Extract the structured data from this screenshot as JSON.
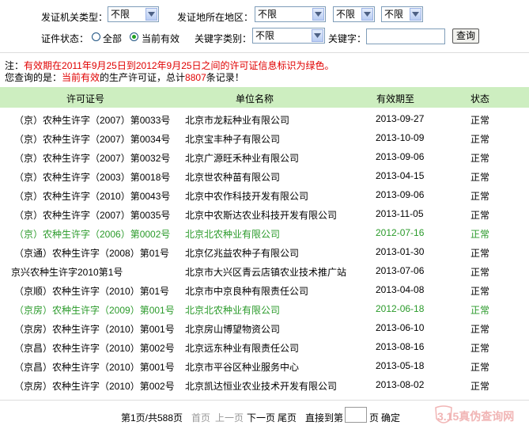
{
  "filters": {
    "issuer_type_label": "发证机关类型：",
    "issuer_type_value": "不限",
    "region_label": "发证地所在地区：",
    "region_values": [
      "不限",
      "不限",
      "不限"
    ],
    "status_label": "证件状态：",
    "radio_all_label": "全部",
    "radio_current_label": "当前有效",
    "keyword_type_label": "关键字类别：",
    "keyword_type_value": "不限",
    "keyword_label": "关键字：",
    "keyword_value": "",
    "search_button": "查询"
  },
  "notice": {
    "prefix": "注：",
    "text": "有效期在2011年9月25日到2012年9月25日之间的许可证信息标识为绿色。",
    "query_prefix": "您查询的是：",
    "query_status": "当前有效",
    "query_mid": "的生产许可证，总计",
    "query_count": "8807",
    "query_suffix": "条记录！"
  },
  "table": {
    "columns": [
      "许可证号",
      "单位名称",
      "有效期至",
      "状态"
    ],
    "rows": [
      {
        "license": "（京）农种生许字（2007）第0033号",
        "company": "北京市龙耘种业有限公司",
        "valid_until": "2013-09-27",
        "status": "正常",
        "highlight": false
      },
      {
        "license": "（京）农种生许字（2007）第0034号",
        "company": "北京宝丰种子有限公司",
        "valid_until": "2013-10-09",
        "status": "正常",
        "highlight": false
      },
      {
        "license": "（京）农种生许字（2007）第0032号",
        "company": "北京广源旺禾种业有限公司",
        "valid_until": "2013-09-06",
        "status": "正常",
        "highlight": false
      },
      {
        "license": "（京）农种生许字（2003）第0018号",
        "company": "北京世农种苗有限公司",
        "valid_until": "2013-04-15",
        "status": "正常",
        "highlight": false
      },
      {
        "license": "（京）农种生许字（2010）第0043号",
        "company": "北京中农作科技开发有限公司",
        "valid_until": "2013-09-06",
        "status": "正常",
        "highlight": false
      },
      {
        "license": "（京）农种生许字（2007）第0035号",
        "company": "北京中农斯达农业科技开发有限公司",
        "valid_until": "2013-11-05",
        "status": "正常",
        "highlight": false
      },
      {
        "license": "（京）农种生许字（2006）第0002号",
        "company": "北京北农种业有限公司",
        "valid_until": "2012-07-16",
        "status": "正常",
        "highlight": true
      },
      {
        "license": "（京通）农种生许字（2008）第01号",
        "company": "北京亿兆益农种子有限公司",
        "valid_until": "2013-01-30",
        "status": "正常",
        "highlight": false
      },
      {
        "license": "京兴农种生许字2010第1号",
        "company": "北京市大兴区青云店镇农业技术推广站",
        "valid_until": "2013-07-06",
        "status": "正常",
        "highlight": false
      },
      {
        "license": "（京顺）农种生许字（2010）第01号",
        "company": "北京市中京良种有限责任公司",
        "valid_until": "2013-04-08",
        "status": "正常",
        "highlight": false
      },
      {
        "license": "（京房）农种生许字（2009）第001号",
        "company": "北京北农种业有限公司",
        "valid_until": "2012-06-18",
        "status": "正常",
        "highlight": true
      },
      {
        "license": "（京房）农种生许字（2010）第001号",
        "company": "北京房山博望物资公司",
        "valid_until": "2013-06-10",
        "status": "正常",
        "highlight": false
      },
      {
        "license": "（京昌）农种生许字（2010）第002号",
        "company": "北京远东种业有限责任公司",
        "valid_until": "2013-08-16",
        "status": "正常",
        "highlight": false
      },
      {
        "license": "（京昌）农种生许字（2010）第001号",
        "company": "北京市平谷区种业服务中心",
        "valid_until": "2013-05-18",
        "status": "正常",
        "highlight": false
      },
      {
        "license": "（京房）农种生许字（2010）第002号",
        "company": "北京凯达恒业农业技术开发有限公司",
        "valid_until": "2013-08-02",
        "status": "正常",
        "highlight": false
      }
    ]
  },
  "pager": {
    "page_info": "第1页/共588页",
    "first": "首页",
    "prev": "上一页",
    "next": "下一页",
    "last": "尾页",
    "goto_prefix": "直接到第",
    "goto_suffix": "页",
    "confirm": "确定"
  },
  "watermark": {
    "text": "3.15真伪查询网"
  },
  "colors": {
    "header_bg": "#cdeec0",
    "highlight_text": "#2a9a2a",
    "notice_red": "#e00000"
  }
}
